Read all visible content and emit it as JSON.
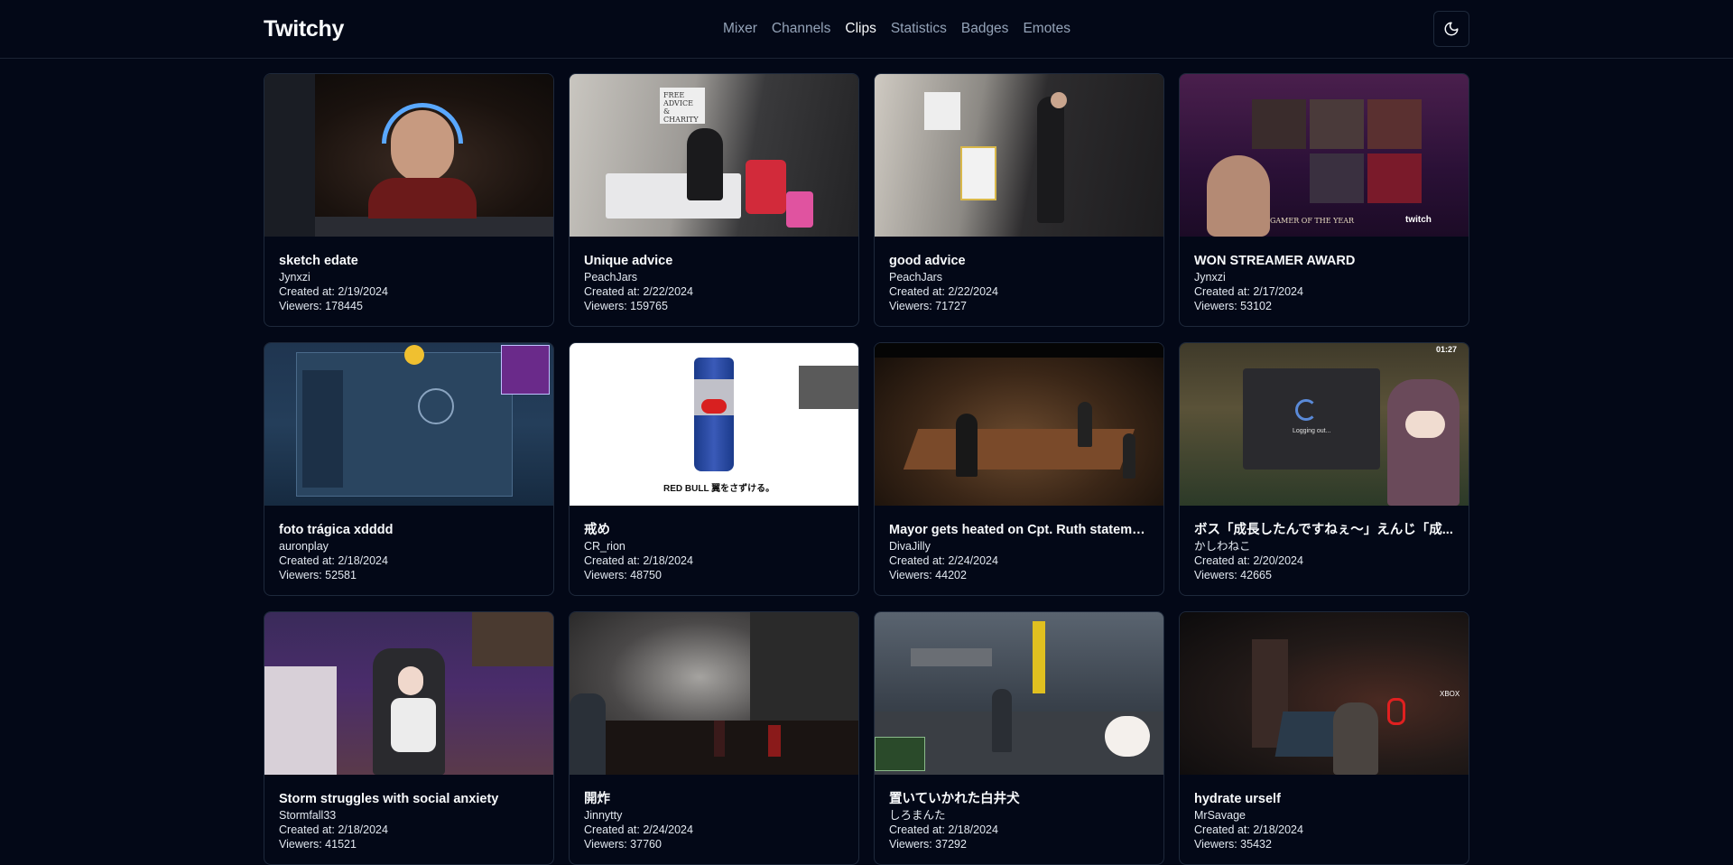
{
  "app": {
    "title": "Twitchy"
  },
  "nav": {
    "items": [
      {
        "label": "Mixer",
        "active": false
      },
      {
        "label": "Channels",
        "active": false
      },
      {
        "label": "Clips",
        "active": true
      },
      {
        "label": "Statistics",
        "active": false
      },
      {
        "label": "Badges",
        "active": false
      },
      {
        "label": "Emotes",
        "active": false
      }
    ]
  },
  "theme_toggle": {
    "icon": "moon-icon"
  },
  "clips": [
    {
      "title": "sketch edate",
      "channel": "Jynxzi",
      "created": "Created at: 2/19/2024",
      "viewers": "Viewers: 178445"
    },
    {
      "title": "Unique advice",
      "channel": "PeachJars",
      "created": "Created at: 2/22/2024",
      "viewers": "Viewers: 159765"
    },
    {
      "title": "good advice",
      "channel": "PeachJars",
      "created": "Created at: 2/22/2024",
      "viewers": "Viewers: 71727"
    },
    {
      "title": "WON STREAMER AWARD",
      "channel": "Jynxzi",
      "created": "Created at: 2/17/2024",
      "viewers": "Viewers: 53102"
    },
    {
      "title": "foto trágica xdddd",
      "channel": "auronplay",
      "created": "Created at: 2/18/2024",
      "viewers": "Viewers: 52581"
    },
    {
      "title": "戒め",
      "channel": "CR_rion",
      "created": "Created at: 2/18/2024",
      "viewers": "Viewers: 48750"
    },
    {
      "title": "Mayor gets heated on Cpt. Ruth statement",
      "channel": "DivaJilly",
      "created": "Created at: 2/24/2024",
      "viewers": "Viewers: 44202"
    },
    {
      "title": "ボス「成長したんですねぇ〜」えんじ「成...",
      "channel": "かしわねこ",
      "created": "Created at: 2/20/2024",
      "viewers": "Viewers: 42665"
    },
    {
      "title": "Storm struggles with social anxiety",
      "channel": "Stormfall33",
      "created": "Created at: 2/18/2024",
      "viewers": "Viewers: 41521"
    },
    {
      "title": "開炸",
      "channel": "Jinnytty",
      "created": "Created at: 2/24/2024",
      "viewers": "Viewers: 37760"
    },
    {
      "title": "置いていかれた白井犬",
      "channel": "しろまんた",
      "created": "Created at: 2/18/2024",
      "viewers": "Viewers: 37292"
    },
    {
      "title": "hydrate urself",
      "channel": "MrSavage",
      "created": "Created at: 2/18/2024",
      "viewers": "Viewers: 35432"
    }
  ],
  "thumb_text": {
    "redbull_caption": "RED BULL 翼をさずける。",
    "logging_out": "Logging out...",
    "free_advice": "FREE ADVICE & CHARITY",
    "gamer_of_the_year": "GAMER OF THE YEAR",
    "twitch": "twitch",
    "xbox": "XBOX",
    "timer": "01:27"
  }
}
